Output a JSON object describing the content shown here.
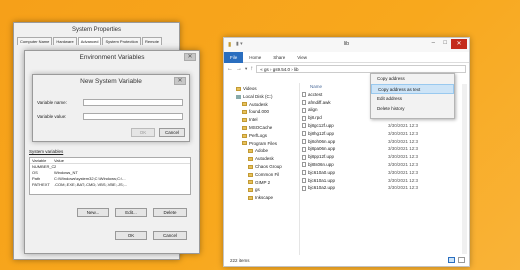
{
  "system_properties": {
    "title": "System Properties",
    "tabs": [
      "Computer Name",
      "Hardware",
      "Advanced",
      "System Protection",
      "Remote"
    ],
    "active_tab": "Advanced"
  },
  "environment_variables": {
    "title": "Environment Variables",
    "system_variables_label": "System variables",
    "columns": [
      "Variable",
      "Value"
    ],
    "rows": [
      {
        "name": "NUMBER_OF_P...",
        "value": "2"
      },
      {
        "name": "OS",
        "value": "Windows_NT"
      },
      {
        "name": "Path",
        "value": "C:\\Windows\\system32;C:\\Windows;C:\\..."
      },
      {
        "name": "PATHEXT",
        "value": ".COM;.EXE;.BAT;.CMD;.VBS;.VBE;.JS;..."
      }
    ],
    "buttons": {
      "new": "New...",
      "edit": "Edit...",
      "delete": "Delete",
      "ok": "OK",
      "cancel": "Cancel"
    }
  },
  "new_variable_dialog": {
    "title": "New System Variable",
    "name_label": "Variable name:",
    "value_label": "Variable value:",
    "name_value": "",
    "value_value": "",
    "ok": "OK",
    "cancel": "Cancel"
  },
  "explorer": {
    "title": "lib",
    "ribbon_tabs": [
      "File",
      "Home",
      "Share",
      "View"
    ],
    "address": "« gs › gs9.54.0 › lib",
    "nav_items": [
      {
        "label": "Videos",
        "kind": "folder"
      },
      {
        "label": "Local Disk (C:)",
        "kind": "drive"
      },
      {
        "label": "Autodesk",
        "kind": "folder"
      },
      {
        "label": "found.000",
        "kind": "folder"
      },
      {
        "label": "Intel",
        "kind": "folder"
      },
      {
        "label": "MSOCache",
        "kind": "folder"
      },
      {
        "label": "PerfLogs",
        "kind": "folder"
      },
      {
        "label": "Program Files",
        "kind": "folder"
      },
      {
        "label": "Adobe",
        "kind": "folder"
      },
      {
        "label": "Autodesk",
        "kind": "folder"
      },
      {
        "label": "Chaos Group",
        "kind": "folder"
      },
      {
        "label": "Common Fil",
        "kind": "folder"
      },
      {
        "label": "GIMP 2",
        "kind": "folder"
      },
      {
        "label": "gs",
        "kind": "folder"
      },
      {
        "label": "Inkscape",
        "kind": "folder"
      }
    ],
    "column_header": "Name",
    "files": [
      {
        "name": "acctest",
        "date": ""
      },
      {
        "name": "afmdiff.awk",
        "date": ""
      },
      {
        "name": "align",
        "date": ""
      },
      {
        "name": "bj8.rpd",
        "date": "3/30/2021 12:3"
      },
      {
        "name": "bj8gc12f.upp",
        "date": "3/30/2021 12:3"
      },
      {
        "name": "bj8hg12f.upp",
        "date": "3/30/2021 12:3"
      },
      {
        "name": "bj8oh06n.upp",
        "date": "3/30/2021 12:3"
      },
      {
        "name": "bj8pa06n.upp",
        "date": "3/30/2021 12:3"
      },
      {
        "name": "bj8pp12f.upp",
        "date": "3/30/2021 12:3"
      },
      {
        "name": "bj8ts06n.upp",
        "date": "3/30/2021 12:3"
      },
      {
        "name": "bjc610a0.upp",
        "date": "3/30/2021 12:3"
      },
      {
        "name": "bjc610a1.upp",
        "date": "3/30/2021 12:3"
      },
      {
        "name": "bjc610a2.upp",
        "date": "3/30/2021 12:3"
      }
    ],
    "status": "222 items"
  },
  "context_menu": {
    "items": [
      "Copy address",
      "Copy address as text",
      "Edit address",
      "Delete history"
    ],
    "highlighted": "Copy address as text"
  }
}
